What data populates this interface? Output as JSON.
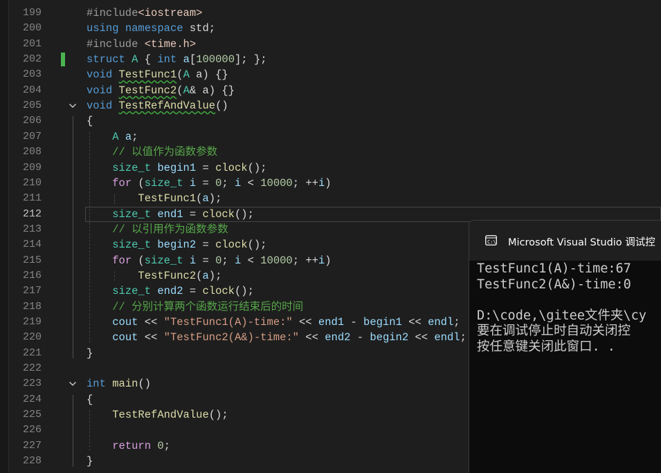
{
  "editor": {
    "current_line": "212",
    "lines": [
      {
        "no": "199",
        "tokens": [
          {
            "t": "#include",
            "c": "pp"
          },
          {
            "t": "<iostream>",
            "c": "inc"
          }
        ]
      },
      {
        "no": "200",
        "tokens": [
          {
            "t": "using",
            "c": "kw"
          },
          {
            "t": " ",
            "c": "plain"
          },
          {
            "t": "namespace",
            "c": "kw"
          },
          {
            "t": " std;",
            "c": "plain"
          }
        ]
      },
      {
        "no": "201",
        "tokens": [
          {
            "t": "#include",
            "c": "pp"
          },
          {
            "t": " <time.h>",
            "c": "inc"
          }
        ]
      },
      {
        "no": "202",
        "tokens": [
          {
            "t": "struct",
            "c": "kw"
          },
          {
            "t": " ",
            "c": "plain"
          },
          {
            "t": "A",
            "c": "ty"
          },
          {
            "t": " { ",
            "c": "plain"
          },
          {
            "t": "int",
            "c": "kw"
          },
          {
            "t": " ",
            "c": "plain"
          },
          {
            "t": "a",
            "c": "var"
          },
          {
            "t": "[",
            "c": "plain"
          },
          {
            "t": "100000",
            "c": "num"
          },
          {
            "t": "]; };",
            "c": "plain"
          }
        ]
      },
      {
        "no": "203",
        "tokens": [
          {
            "t": "void",
            "c": "kw"
          },
          {
            "t": " ",
            "c": "plain"
          },
          {
            "t": "TestFunc1",
            "c": "fn",
            "squig": true
          },
          {
            "t": "(",
            "c": "plain"
          },
          {
            "t": "A",
            "c": "ty"
          },
          {
            "t": " a) {}",
            "c": "plain"
          }
        ]
      },
      {
        "no": "204",
        "tokens": [
          {
            "t": "void",
            "c": "kw"
          },
          {
            "t": " ",
            "c": "plain"
          },
          {
            "t": "TestFunc2",
            "c": "fn",
            "squig": true
          },
          {
            "t": "(",
            "c": "plain"
          },
          {
            "t": "A",
            "c": "ty"
          },
          {
            "t": "& a) {}",
            "c": "plain"
          }
        ]
      },
      {
        "no": "205",
        "fold": true,
        "tokens": [
          {
            "t": "void",
            "c": "kw"
          },
          {
            "t": " ",
            "c": "plain"
          },
          {
            "t": "TestRefAndValue",
            "c": "fn",
            "squig": true
          },
          {
            "t": "()",
            "c": "plain"
          }
        ]
      },
      {
        "no": "206",
        "tokens": [
          {
            "t": "{",
            "c": "plain"
          }
        ]
      },
      {
        "no": "207",
        "tokens": [
          {
            "t": "    ",
            "c": "plain"
          },
          {
            "t": "A",
            "c": "ty"
          },
          {
            "t": " ",
            "c": "plain"
          },
          {
            "t": "a",
            "c": "var"
          },
          {
            "t": ";",
            "c": "plain"
          }
        ]
      },
      {
        "no": "208",
        "tokens": [
          {
            "t": "    ",
            "c": "plain"
          },
          {
            "t": "// 以值作为函数参数",
            "c": "cm"
          }
        ]
      },
      {
        "no": "209",
        "tokens": [
          {
            "t": "    ",
            "c": "plain"
          },
          {
            "t": "size_t",
            "c": "ty"
          },
          {
            "t": " ",
            "c": "plain"
          },
          {
            "t": "begin1",
            "c": "var"
          },
          {
            "t": " = ",
            "c": "plain"
          },
          {
            "t": "clock",
            "c": "fn"
          },
          {
            "t": "();",
            "c": "plain"
          }
        ]
      },
      {
        "no": "210",
        "tokens": [
          {
            "t": "    ",
            "c": "plain"
          },
          {
            "t": "for",
            "c": "kw2"
          },
          {
            "t": " (",
            "c": "plain"
          },
          {
            "t": "size_t",
            "c": "ty"
          },
          {
            "t": " ",
            "c": "plain"
          },
          {
            "t": "i",
            "c": "var"
          },
          {
            "t": " = ",
            "c": "plain"
          },
          {
            "t": "0",
            "c": "num"
          },
          {
            "t": "; ",
            "c": "plain"
          },
          {
            "t": "i",
            "c": "var"
          },
          {
            "t": " < ",
            "c": "plain"
          },
          {
            "t": "10000",
            "c": "num"
          },
          {
            "t": "; ++",
            "c": "plain"
          },
          {
            "t": "i",
            "c": "var"
          },
          {
            "t": ")",
            "c": "plain"
          }
        ]
      },
      {
        "no": "211",
        "tokens": [
          {
            "t": "        ",
            "c": "plain"
          },
          {
            "t": "TestFunc1",
            "c": "fn"
          },
          {
            "t": "(",
            "c": "plain"
          },
          {
            "t": "a",
            "c": "var"
          },
          {
            "t": ");",
            "c": "plain"
          }
        ]
      },
      {
        "no": "212",
        "tokens": [
          {
            "t": "    ",
            "c": "plain"
          },
          {
            "t": "size_t",
            "c": "ty"
          },
          {
            "t": " ",
            "c": "plain"
          },
          {
            "t": "end1",
            "c": "var"
          },
          {
            "t": " = ",
            "c": "plain"
          },
          {
            "t": "clock",
            "c": "fn"
          },
          {
            "t": "();",
            "c": "plain"
          }
        ]
      },
      {
        "no": "213",
        "tokens": [
          {
            "t": "    ",
            "c": "plain"
          },
          {
            "t": "// 以引用作为函数参数",
            "c": "cm"
          }
        ]
      },
      {
        "no": "214",
        "tokens": [
          {
            "t": "    ",
            "c": "plain"
          },
          {
            "t": "size_t",
            "c": "ty"
          },
          {
            "t": " ",
            "c": "plain"
          },
          {
            "t": "begin2",
            "c": "var"
          },
          {
            "t": " = ",
            "c": "plain"
          },
          {
            "t": "clock",
            "c": "fn"
          },
          {
            "t": "();",
            "c": "plain"
          }
        ]
      },
      {
        "no": "215",
        "tokens": [
          {
            "t": "    ",
            "c": "plain"
          },
          {
            "t": "for",
            "c": "kw2"
          },
          {
            "t": " (",
            "c": "plain"
          },
          {
            "t": "size_t",
            "c": "ty"
          },
          {
            "t": " ",
            "c": "plain"
          },
          {
            "t": "i",
            "c": "var"
          },
          {
            "t": " = ",
            "c": "plain"
          },
          {
            "t": "0",
            "c": "num"
          },
          {
            "t": "; ",
            "c": "plain"
          },
          {
            "t": "i",
            "c": "var"
          },
          {
            "t": " < ",
            "c": "plain"
          },
          {
            "t": "10000",
            "c": "num"
          },
          {
            "t": "; ++",
            "c": "plain"
          },
          {
            "t": "i",
            "c": "var"
          },
          {
            "t": ")",
            "c": "plain"
          }
        ]
      },
      {
        "no": "216",
        "tokens": [
          {
            "t": "        ",
            "c": "plain"
          },
          {
            "t": "TestFunc2",
            "c": "fn"
          },
          {
            "t": "(",
            "c": "plain"
          },
          {
            "t": "a",
            "c": "var"
          },
          {
            "t": ");",
            "c": "plain"
          }
        ]
      },
      {
        "no": "217",
        "tokens": [
          {
            "t": "    ",
            "c": "plain"
          },
          {
            "t": "size_t",
            "c": "ty"
          },
          {
            "t": " ",
            "c": "plain"
          },
          {
            "t": "end2",
            "c": "var"
          },
          {
            "t": " = ",
            "c": "plain"
          },
          {
            "t": "clock",
            "c": "fn"
          },
          {
            "t": "();",
            "c": "plain"
          }
        ]
      },
      {
        "no": "218",
        "tokens": [
          {
            "t": "    ",
            "c": "plain"
          },
          {
            "t": "// 分别计算两个函数运行结束后的时间",
            "c": "cm"
          }
        ]
      },
      {
        "no": "219",
        "tokens": [
          {
            "t": "    ",
            "c": "plain"
          },
          {
            "t": "cout",
            "c": "var"
          },
          {
            "t": " << ",
            "c": "plain"
          },
          {
            "t": "\"TestFunc1(A)-time:\"",
            "c": "str"
          },
          {
            "t": " << ",
            "c": "plain"
          },
          {
            "t": "end1",
            "c": "var"
          },
          {
            "t": " - ",
            "c": "plain"
          },
          {
            "t": "begin1",
            "c": "var"
          },
          {
            "t": " << ",
            "c": "plain"
          },
          {
            "t": "endl",
            "c": "var"
          },
          {
            "t": ";",
            "c": "plain"
          }
        ]
      },
      {
        "no": "220",
        "tokens": [
          {
            "t": "    ",
            "c": "plain"
          },
          {
            "t": "cout",
            "c": "var"
          },
          {
            "t": " << ",
            "c": "plain"
          },
          {
            "t": "\"TestFunc2(A&)-time:\"",
            "c": "str"
          },
          {
            "t": " << ",
            "c": "plain"
          },
          {
            "t": "end2",
            "c": "var"
          },
          {
            "t": " - ",
            "c": "plain"
          },
          {
            "t": "begin2",
            "c": "var"
          },
          {
            "t": " << ",
            "c": "plain"
          },
          {
            "t": "endl",
            "c": "var"
          },
          {
            "t": ";",
            "c": "plain"
          }
        ]
      },
      {
        "no": "221",
        "tokens": [
          {
            "t": "}",
            "c": "plain"
          }
        ]
      },
      {
        "no": "222",
        "tokens": []
      },
      {
        "no": "223",
        "fold": true,
        "tokens": [
          {
            "t": "int",
            "c": "kw"
          },
          {
            "t": " ",
            "c": "plain"
          },
          {
            "t": "main",
            "c": "fn"
          },
          {
            "t": "()",
            "c": "plain"
          }
        ]
      },
      {
        "no": "224",
        "tokens": [
          {
            "t": "{",
            "c": "plain"
          }
        ]
      },
      {
        "no": "225",
        "tokens": [
          {
            "t": "    ",
            "c": "plain"
          },
          {
            "t": "TestRefAndValue",
            "c": "fn"
          },
          {
            "t": "();",
            "c": "plain"
          }
        ]
      },
      {
        "no": "226",
        "tokens": []
      },
      {
        "no": "227",
        "tokens": [
          {
            "t": "    ",
            "c": "plain"
          },
          {
            "t": "return",
            "c": "kw2"
          },
          {
            "t": " ",
            "c": "plain"
          },
          {
            "t": "0",
            "c": "num"
          },
          {
            "t": ";",
            "c": "plain"
          }
        ]
      },
      {
        "no": "228",
        "tokens": [
          {
            "t": "}",
            "c": "plain"
          }
        ]
      }
    ]
  },
  "console": {
    "title": "Microsoft Visual Studio 调试控",
    "icon": "console-icon",
    "lines": [
      "TestFunc1(A)-time:67",
      "TestFunc2(A&)-time:0",
      "",
      "D:\\code,\\gitee文件夹\\cy",
      "要在调试停止时自动关闭控",
      "按任意键关闭此窗口. ."
    ]
  },
  "colors": {
    "background": "#1e1e1e",
    "keyword": "#569cd6",
    "control": "#d8a0df",
    "type": "#4ec9b0",
    "function": "#dcdcaa",
    "variable": "#9cdcfe",
    "number": "#b5cea8",
    "string": "#d69d85",
    "comment": "#57a64a",
    "change_bar": "#4ab450"
  }
}
